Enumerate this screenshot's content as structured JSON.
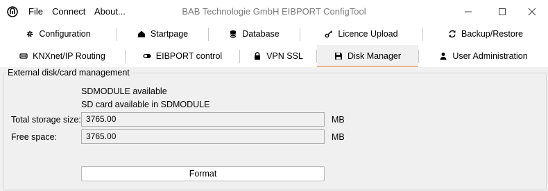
{
  "window": {
    "title": "BAB Technologie GmbH EIBPORT ConfigTool",
    "menu": [
      "File",
      "Connect",
      "About..."
    ]
  },
  "tabs": {
    "row1": [
      {
        "label": "Configuration",
        "icon": "gear-icon"
      },
      {
        "label": "Startpage",
        "icon": "home-icon"
      },
      {
        "label": "Database",
        "icon": "database-icon"
      },
      {
        "label": "Licence Upload",
        "icon": "key-icon"
      },
      {
        "label": "Backup/Restore",
        "icon": "sync-icon"
      }
    ],
    "row2": [
      {
        "label": "KNXnet/IP Routing",
        "icon": "network-icon"
      },
      {
        "label": "EIBPORT control",
        "icon": "toggle-icon"
      },
      {
        "label": "VPN SSL",
        "icon": "lock-icon"
      },
      {
        "label": "Disk Manager",
        "icon": "floppy-disk-icon",
        "selected": true
      },
      {
        "label": "User Administration",
        "icon": "user-icon"
      }
    ]
  },
  "disk_panel": {
    "group_title": "External disk/card management",
    "status_line1": "SDMODULE available",
    "status_line2": "SD card available in SDMODULE",
    "total_label": "Total storage size:",
    "total_value": "3765.00",
    "total_unit": "MB",
    "free_label": "Free space:",
    "free_value": "3765.00",
    "free_unit": "MB",
    "format_button": "Format"
  },
  "colors": {
    "selected_tab_underline": "#f2b38a",
    "title_text": "#7a7a7a"
  }
}
